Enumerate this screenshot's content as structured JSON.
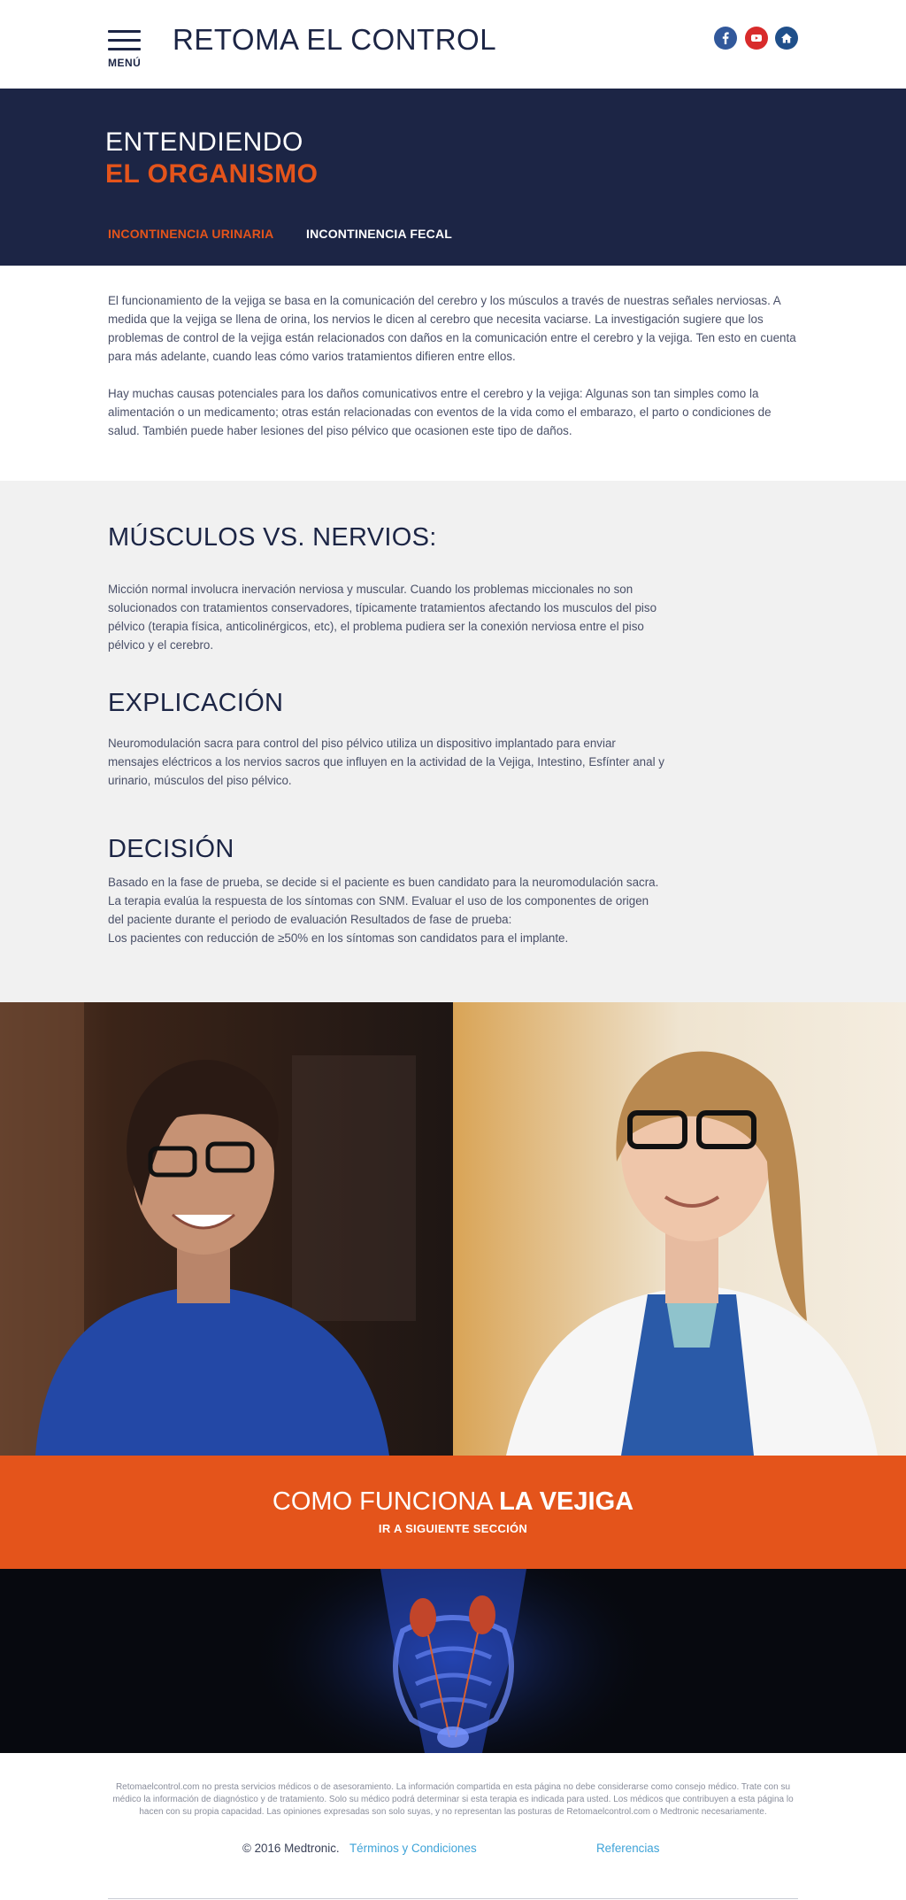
{
  "header": {
    "title": "RETOMA EL CONTROL",
    "menu_label": "MENÚ",
    "social": [
      {
        "name": "facebook",
        "icon": "facebook-icon"
      },
      {
        "name": "youtube",
        "icon": "youtube-icon"
      },
      {
        "name": "home",
        "icon": "home-icon"
      }
    ]
  },
  "hero": {
    "line1": "ENTENDIENDO",
    "line2": "EL ORGANISMO",
    "tabs": [
      {
        "label": "INCONTINENCIA URINARIA",
        "active": true
      },
      {
        "label": "INCONTINENCIA FECAL",
        "active": false
      }
    ]
  },
  "intro": {
    "p1": "El funcionamiento de la vejiga se basa en la comunicación del cerebro y los músculos a través de nuestras señales nerviosas. A medida que la vejiga se llena de orina, los nervios le dicen al cerebro que necesita vaciarse. La investigación sugiere que los problemas de control de la vejiga están relacionados con daños en la comunicación entre el cerebro y la vejiga. Ten esto en cuenta para más adelante, cuando leas cómo varios tratamientos difieren entre ellos.",
    "p2": "Hay muchas causas potenciales para los daños comunicativos entre el cerebro y la vejiga: Algunas son tan simples como la alimentación o un medicamento; otras están relacionadas con eventos de la vida como el embarazo, el parto o condiciones de salud. También puede haber lesiones del piso pélvico que ocasionen este tipo de daños."
  },
  "sections": [
    {
      "heading": "MÚSCULOS VS. NERVIOS:",
      "body": "Micción normal involucra inervación nerviosa y muscular. Cuando los problemas miccionales no son solucionados con tratamientos conservadores, típicamente tratamientos afectando los musculos del piso pélvico (terapia física, anticolinérgicos, etc), el problema pudiera ser la conexión nerviosa entre el piso pélvico y el cerebro."
    },
    {
      "heading": "EXPLICACIÓN",
      "body": "Neuromodulación sacra para control del piso pélvico utiliza un dispositivo implantado para enviar mensajes eléctricos a los nervios sacros que influyen en la actividad de la Vejiga, Intestino, Esfínter anal y urinario, músculos del piso pélvico."
    },
    {
      "heading": "DECISIÓN",
      "body_lines": [
        "Basado en la fase de prueba, se decide si el paciente es buen candidato para la neuromodulación sacra.  La terapia evalúa la respuesta de los síntomas con SNM.  Evaluar el uso de los componentes de origen del paciente durante el periodo de evaluación Resultados de fase de prueba:",
        "Los pacientes con reducción de ≥50% en los síntomas son candidatos para el implante."
      ]
    }
  ],
  "cta": {
    "title_light": "COMO FUNCIONA ",
    "title_bold": "LA VEJIGA",
    "subtitle": "IR A SIGUIENTE SECCIÓN"
  },
  "footer": {
    "disclaimer": "Retomaelcontrol.com no presta servicios médicos o de asesoramiento. La información compartida en esta página no debe considerarse como consejo médico. Trate con su médico la información de diagnóstico y de tratamiento. Solo su médico podrá determinar si esta terapia es indicada para usted. Los médicos que contribuyen a esta página lo hacen con su propia capacidad. Las opiniones expresadas son solo suyas, y no representan las posturas de Retomaelcontrol.com o Medtronic necesariamente.",
    "copyright": "© 2016 Medtronic.",
    "terms": "Términos y Condiciones",
    "references": "Referencias"
  },
  "colors": {
    "navy": "#1c2545",
    "accent_orange": "#e4541b",
    "link_blue": "#3ea3d8",
    "grey_bg": "#f1f1f1"
  }
}
